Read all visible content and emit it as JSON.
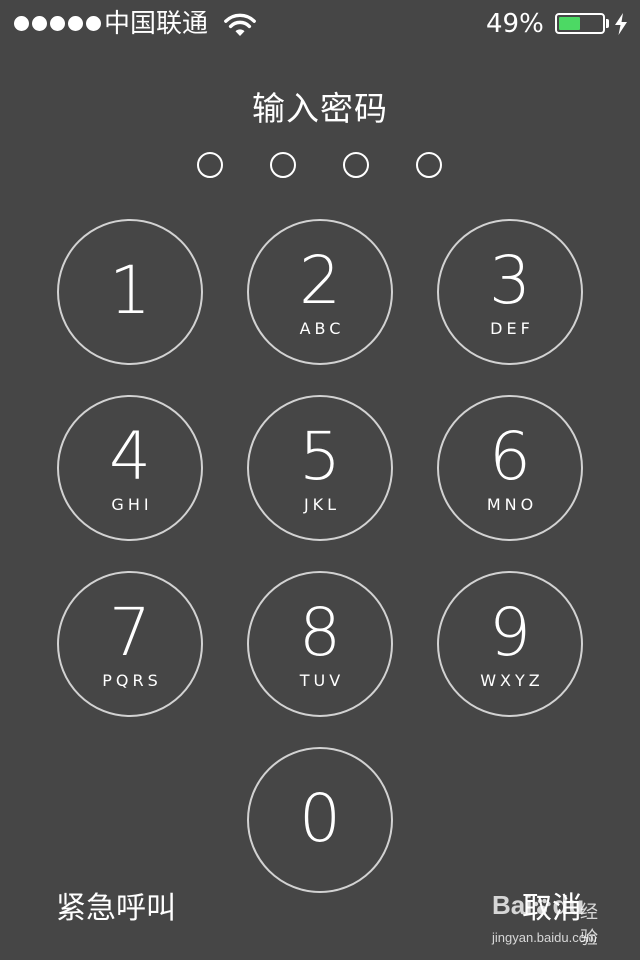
{
  "status_bar": {
    "signal_bars": 5,
    "carrier": "中国联通",
    "wifi_icon": "wifi-icon",
    "battery_percent_label": "49%",
    "battery_level": 0.49,
    "battery_fill_color": "#4cd964",
    "charging_icon": "bolt-icon"
  },
  "lock": {
    "title": "输入密码",
    "passcode_length": 4,
    "entered_digits": 0
  },
  "keypad": {
    "keys": [
      {
        "digit": "1",
        "letters": ""
      },
      {
        "digit": "2",
        "letters": "ABC"
      },
      {
        "digit": "3",
        "letters": "DEF"
      },
      {
        "digit": "4",
        "letters": "GHI"
      },
      {
        "digit": "5",
        "letters": "JKL"
      },
      {
        "digit": "6",
        "letters": "MNO"
      },
      {
        "digit": "7",
        "letters": "PQRS"
      },
      {
        "digit": "8",
        "letters": "TUV"
      },
      {
        "digit": "9",
        "letters": "WXYZ"
      },
      {
        "digit": "0",
        "letters": ""
      }
    ]
  },
  "actions": {
    "emergency_label": "紧急呼叫",
    "cancel_label": "取消"
  },
  "watermark": {
    "brand": "Bai",
    "brand_tail": "du",
    "sub": "经验",
    "url": "jingyan.baidu.com"
  },
  "colors": {
    "background": "#464646",
    "key_ring": "#d2d2d2",
    "text": "#ffffff"
  }
}
